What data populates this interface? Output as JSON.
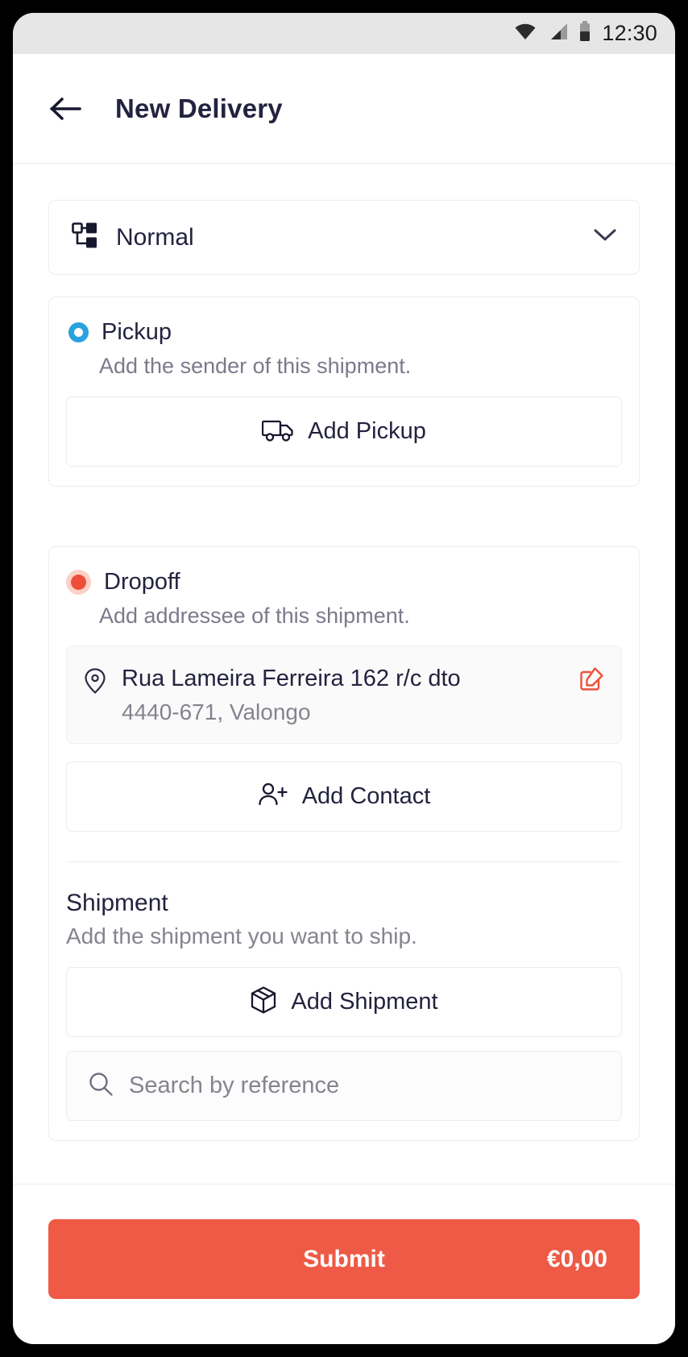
{
  "statusbar": {
    "time": "12:30",
    "icons": [
      "wifi-icon",
      "cellular-signal-icon",
      "battery-icon"
    ]
  },
  "appbar": {
    "back_icon": "arrow-left-icon",
    "title": "New Delivery"
  },
  "service_select": {
    "icon": "flow-hierarchy-icon",
    "value": "Normal",
    "chevron_icon": "chevron-down-icon"
  },
  "pickup": {
    "marker": "blue-ring-marker",
    "title": "Pickup",
    "subtitle": "Add the sender of this shipment.",
    "button": {
      "icon": "truck-icon",
      "label": "Add Pickup"
    }
  },
  "dropoff": {
    "marker": "red-dot-marker",
    "title": "Dropoff",
    "subtitle": "Add addressee of this shipment.",
    "address": {
      "pin_icon": "map-pin-icon",
      "line1": "Rua Lameira Ferreira 162 r/c dto",
      "line2": "4440-671, Valongo",
      "edit_icon": "edit-square-icon"
    },
    "contact_button": {
      "icon": "user-plus-icon",
      "label": "Add Contact"
    }
  },
  "shipment": {
    "title": "Shipment",
    "subtitle": "Add the shipment you want to ship.",
    "button": {
      "icon": "package-box-icon",
      "label": "Add Shipment"
    },
    "search": {
      "icon": "search-icon",
      "placeholder": "Search by reference"
    }
  },
  "bottom": {
    "submit_label": "Submit",
    "price": "€0,00"
  },
  "colors": {
    "accent_red": "#ee5a45",
    "pickup_blue": "#29a3dd",
    "dropoff_red": "#ef4f3a",
    "text_dark": "#23233f",
    "text_muted": "#84848f",
    "border": "#ececec",
    "statusbar_bg": "#e6e6e6"
  }
}
